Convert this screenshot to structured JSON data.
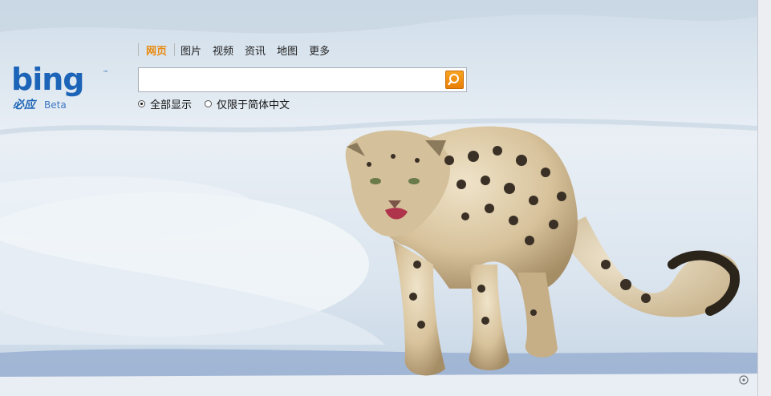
{
  "nav": {
    "items": [
      {
        "label": "网页",
        "active": true
      },
      {
        "label": "图片"
      },
      {
        "label": "视频"
      },
      {
        "label": "资讯"
      },
      {
        "label": "地图"
      },
      {
        "label": "更多"
      }
    ]
  },
  "logo": {
    "wordmark": "bing",
    "cn_name": "必应",
    "badge": "Beta"
  },
  "search": {
    "value": "",
    "placeholder": "",
    "button_icon": "magnifier-icon"
  },
  "scope": {
    "options": [
      {
        "label": "全部显示",
        "selected": true
      },
      {
        "label": "仅限于简体中文",
        "selected": false
      }
    ]
  },
  "background": {
    "subject": "snow leopard on snow",
    "corner_icon": "copyright-info-icon"
  },
  "colors": {
    "accent": "#e98a0e",
    "brand_blue": "#1c64b7"
  }
}
